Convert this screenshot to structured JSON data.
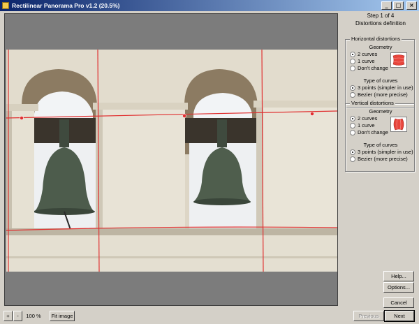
{
  "window": {
    "title": "Rectilinear Panorama Pro v1.2 (20.5%)",
    "minimize_glyph": "_",
    "maximize_glyph": "□",
    "close_glyph": "×"
  },
  "wizard": {
    "step": "Step 1 of 4",
    "subtitle": "Distortions definition"
  },
  "horizontal": {
    "label": "Horizontal distortions",
    "geometry_label": "Geometry",
    "geometry_options": [
      "2 curves",
      "1 curve",
      "Don't change"
    ],
    "geometry_selected": 0,
    "curve_type_label": "Type of curves",
    "curve_options": [
      "3 points (simpler in use)",
      "Bezier (more precise)"
    ],
    "curve_selected": 0
  },
  "vertical": {
    "label": "Vertical distortions",
    "geometry_label": "Geometry",
    "geometry_options": [
      "2 curves",
      "1 curve",
      "Don't change"
    ],
    "geometry_selected": 0,
    "curve_type_label": "Type of curves",
    "curve_options": [
      "3 points (simpler in use)",
      "Bezier (more precise)"
    ],
    "curve_selected": 0
  },
  "buttons": {
    "help": "Help...",
    "options": "Options...",
    "cancel": "Cancel",
    "previous": "Previous",
    "next": "Next",
    "zoom_in": "+",
    "zoom_out": "-",
    "zoom_level": "100 %",
    "fit_image": "Fit image"
  },
  "colors": {
    "guide_line": "#e03030",
    "preview_fill": "#e8453c"
  },
  "icons": {
    "app": "panorama-app-icon",
    "horizontal_preview": "barrel-horizontal-preview-icon",
    "vertical_preview": "barrel-vertical-preview-icon"
  }
}
